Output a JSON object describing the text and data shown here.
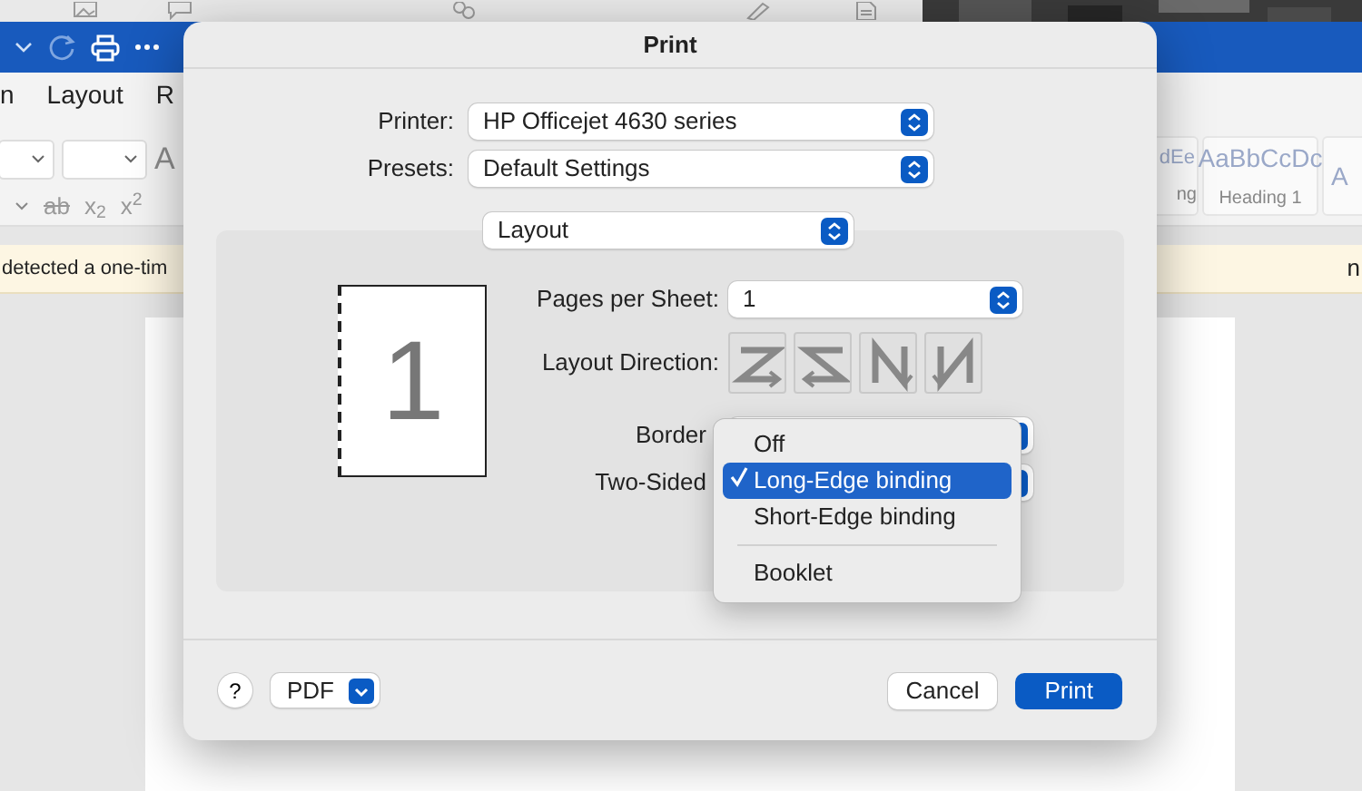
{
  "app": {
    "ribbon_tabs": [
      "n",
      "Layout",
      "R"
    ],
    "format_buttons": [
      "ab",
      "x$_{2}$",
      "x$^{2}$"
    ],
    "font_letter": "A",
    "styles": [
      {
        "preview": "dEe",
        "name": "ng"
      },
      {
        "preview": "AaBbCcDc",
        "name": "Heading 1"
      },
      {
        "preview": "A"
      }
    ],
    "message": "detected a one-tim",
    "message_end": "n"
  },
  "dialog": {
    "title": "Print",
    "fields": [
      {
        "label": "Printer:",
        "value": "HP Officejet 4630 series"
      },
      {
        "label": "Presets:",
        "value": "Default Settings"
      }
    ],
    "section": "Layout",
    "preview_page": "1",
    "pages_per_sheet": {
      "label": "Pages per Sheet:",
      "value": "1"
    },
    "layout_direction": {
      "label": "Layout Direction:"
    },
    "border": {
      "label": "Border"
    },
    "two_sided": {
      "label": "Two-Sided"
    },
    "menu": [
      {
        "kind": "item",
        "label": "Off",
        "checked": false,
        "selected": false
      },
      {
        "kind": "item",
        "label": "Long-Edge binding",
        "checked": true,
        "selected": true
      },
      {
        "kind": "item",
        "label": "Short-Edge binding",
        "checked": false,
        "selected": false
      },
      {
        "kind": "separator"
      },
      {
        "kind": "item",
        "label": "Booklet",
        "checked": false,
        "selected": false
      }
    ],
    "help": "?",
    "pdf": "PDF",
    "cancel": "Cancel",
    "print": "Print"
  }
}
